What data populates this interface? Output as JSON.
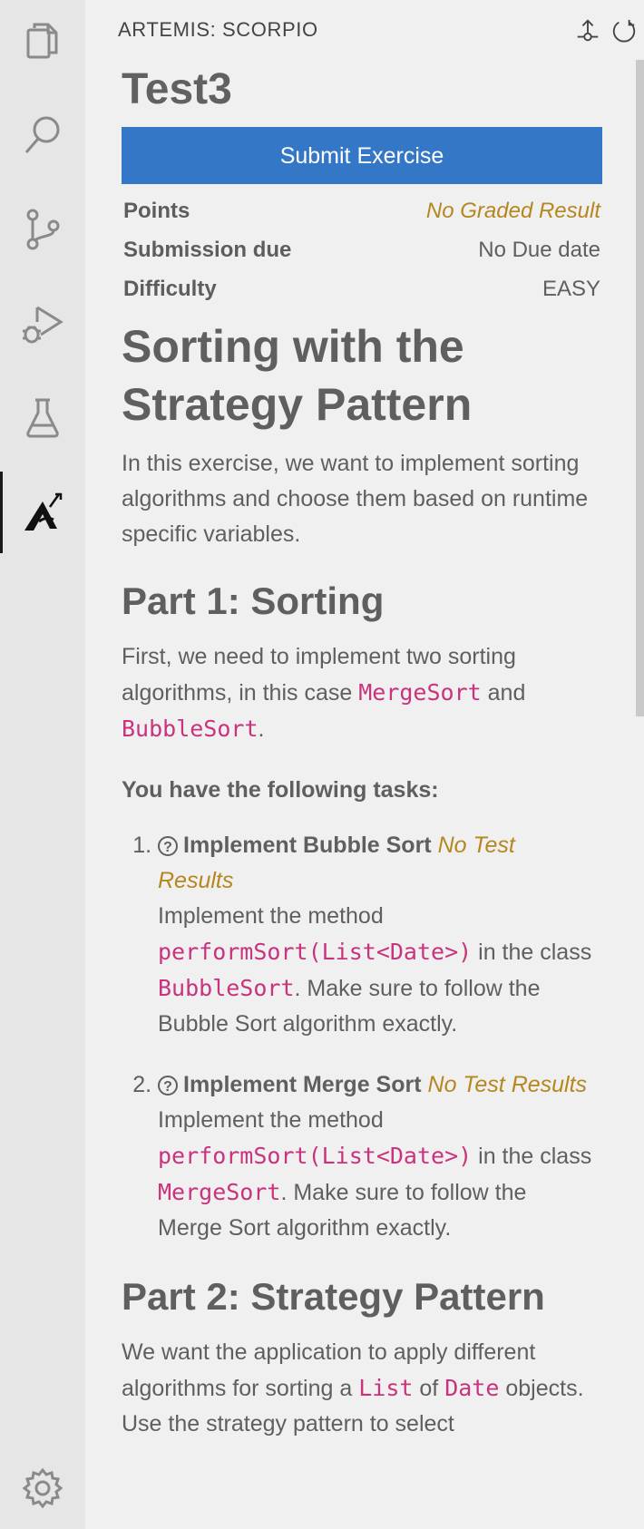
{
  "activity_bar": {
    "items": [
      {
        "icon": "explorer-icon"
      },
      {
        "icon": "search-icon"
      },
      {
        "icon": "source-control-icon"
      },
      {
        "icon": "run-debug-icon"
      },
      {
        "icon": "testing-icon"
      },
      {
        "icon": "artemis-icon",
        "active": true
      }
    ],
    "bottom": {
      "icon": "settings-gear-icon"
    }
  },
  "panel": {
    "title": "ARTEMIS: SCORPIO",
    "actions": [
      "upload-icon",
      "refresh-icon"
    ]
  },
  "exercise": {
    "title": "Test3",
    "submit_label": "Submit Exercise",
    "info": {
      "points_label": "Points",
      "points_value": "No Graded Result",
      "due_label": "Submission due",
      "due_value": "No Due date",
      "difficulty_label": "Difficulty",
      "difficulty_value": "EASY"
    }
  },
  "problem": {
    "heading": "Sorting with the Strategy Pattern",
    "intro": "In this exercise, we want to implement sorting algorithms and choose them based on runtime specific variables.",
    "part1": {
      "heading": "Part 1: Sorting",
      "text_before": "First, we need to implement two sorting algorithms, in this case ",
      "code1": "MergeSort",
      "text_mid": " and ",
      "code2": "BubbleSort",
      "text_end": ".",
      "tasks_heading": "You have the following tasks:",
      "tasks": [
        {
          "icon": "question-circle-icon",
          "name": "Implement Bubble Sort",
          "status": "No Test Results",
          "desc_before": "Implement the method ",
          "method": "performSort(List<Date>)",
          "desc_mid": " in the class ",
          "class": "BubbleSort",
          "desc_end": ". Make sure to follow the Bubble Sort algorithm exactly."
        },
        {
          "icon": "question-circle-icon",
          "name": "Implement Merge Sort",
          "status": "No Test Results",
          "desc_before": "Implement the method ",
          "method": "performSort(List<Date>)",
          "desc_mid": " in the class ",
          "class": "MergeSort",
          "desc_end": ". Make sure to follow the Merge Sort algorithm exactly."
        }
      ]
    },
    "part2": {
      "heading": "Part 2: Strategy Pattern",
      "text_before": "We want the application to apply different algorithms for sorting a ",
      "code1": "List",
      "text_mid": " of ",
      "code2": "Date",
      "text_end": " objects. Use the strategy pattern to select"
    }
  },
  "colors": {
    "accent_button": "#3377c6",
    "warning_text": "#b6861f",
    "code_text": "#c9337e"
  }
}
